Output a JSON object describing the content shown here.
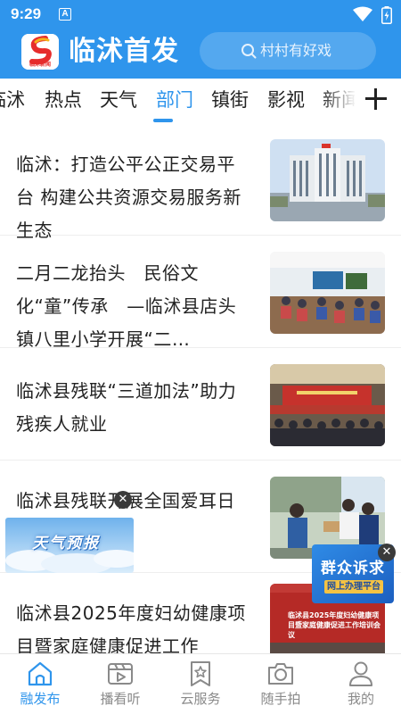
{
  "status_bar": {
    "time": "9:29",
    "notification_letter": "A"
  },
  "header": {
    "app_name": "临沭首发",
    "logo_caption": "临沭新闻",
    "search_placeholder": "村村有好戏"
  },
  "tabs": {
    "items": [
      "临沭",
      "热点",
      "天气",
      "部门",
      "镇街",
      "影视",
      "新闻"
    ],
    "active": "部门"
  },
  "feed": [
    {
      "title": "临沭：打造公平公正交易平台 构建公共资源交易服务新生态",
      "thumb": "government-building"
    },
    {
      "title": "二月二龙抬头　民俗文化“童”传承　—临沭县店头镇八里小学开展“二…",
      "thumb": "classroom"
    },
    {
      "title": "临沭县残联“三道加法”助力残疾人就业",
      "thumb": "conference-hall"
    },
    {
      "title": "临沭县残联开展全国爱耳日宣传活动",
      "thumb": "hearing-check"
    },
    {
      "title": "临沭县2025年度妇幼健康项目暨家庭健康促进工作",
      "thumb": "training-meeting",
      "thumb_caption": "临沭县2025年度妇幼健康项目暨家庭健康促进工作培训会议"
    }
  ],
  "floating": {
    "weather_label": "天气预报",
    "complaint_title": "群众诉求",
    "complaint_subtitle": "网上办理平台"
  },
  "bottom_nav": [
    {
      "label": "融发布",
      "icon": "home-icon",
      "active": true
    },
    {
      "label": "播看听",
      "icon": "video-icon",
      "active": false
    },
    {
      "label": "云服务",
      "icon": "bookmark-star-icon",
      "active": false
    },
    {
      "label": "随手拍",
      "icon": "camera-icon",
      "active": false
    },
    {
      "label": "我的",
      "icon": "user-icon",
      "active": false
    }
  ],
  "colors": {
    "brand": "#2f95ec",
    "text": "#222222",
    "inactive": "#8a8a8a"
  }
}
